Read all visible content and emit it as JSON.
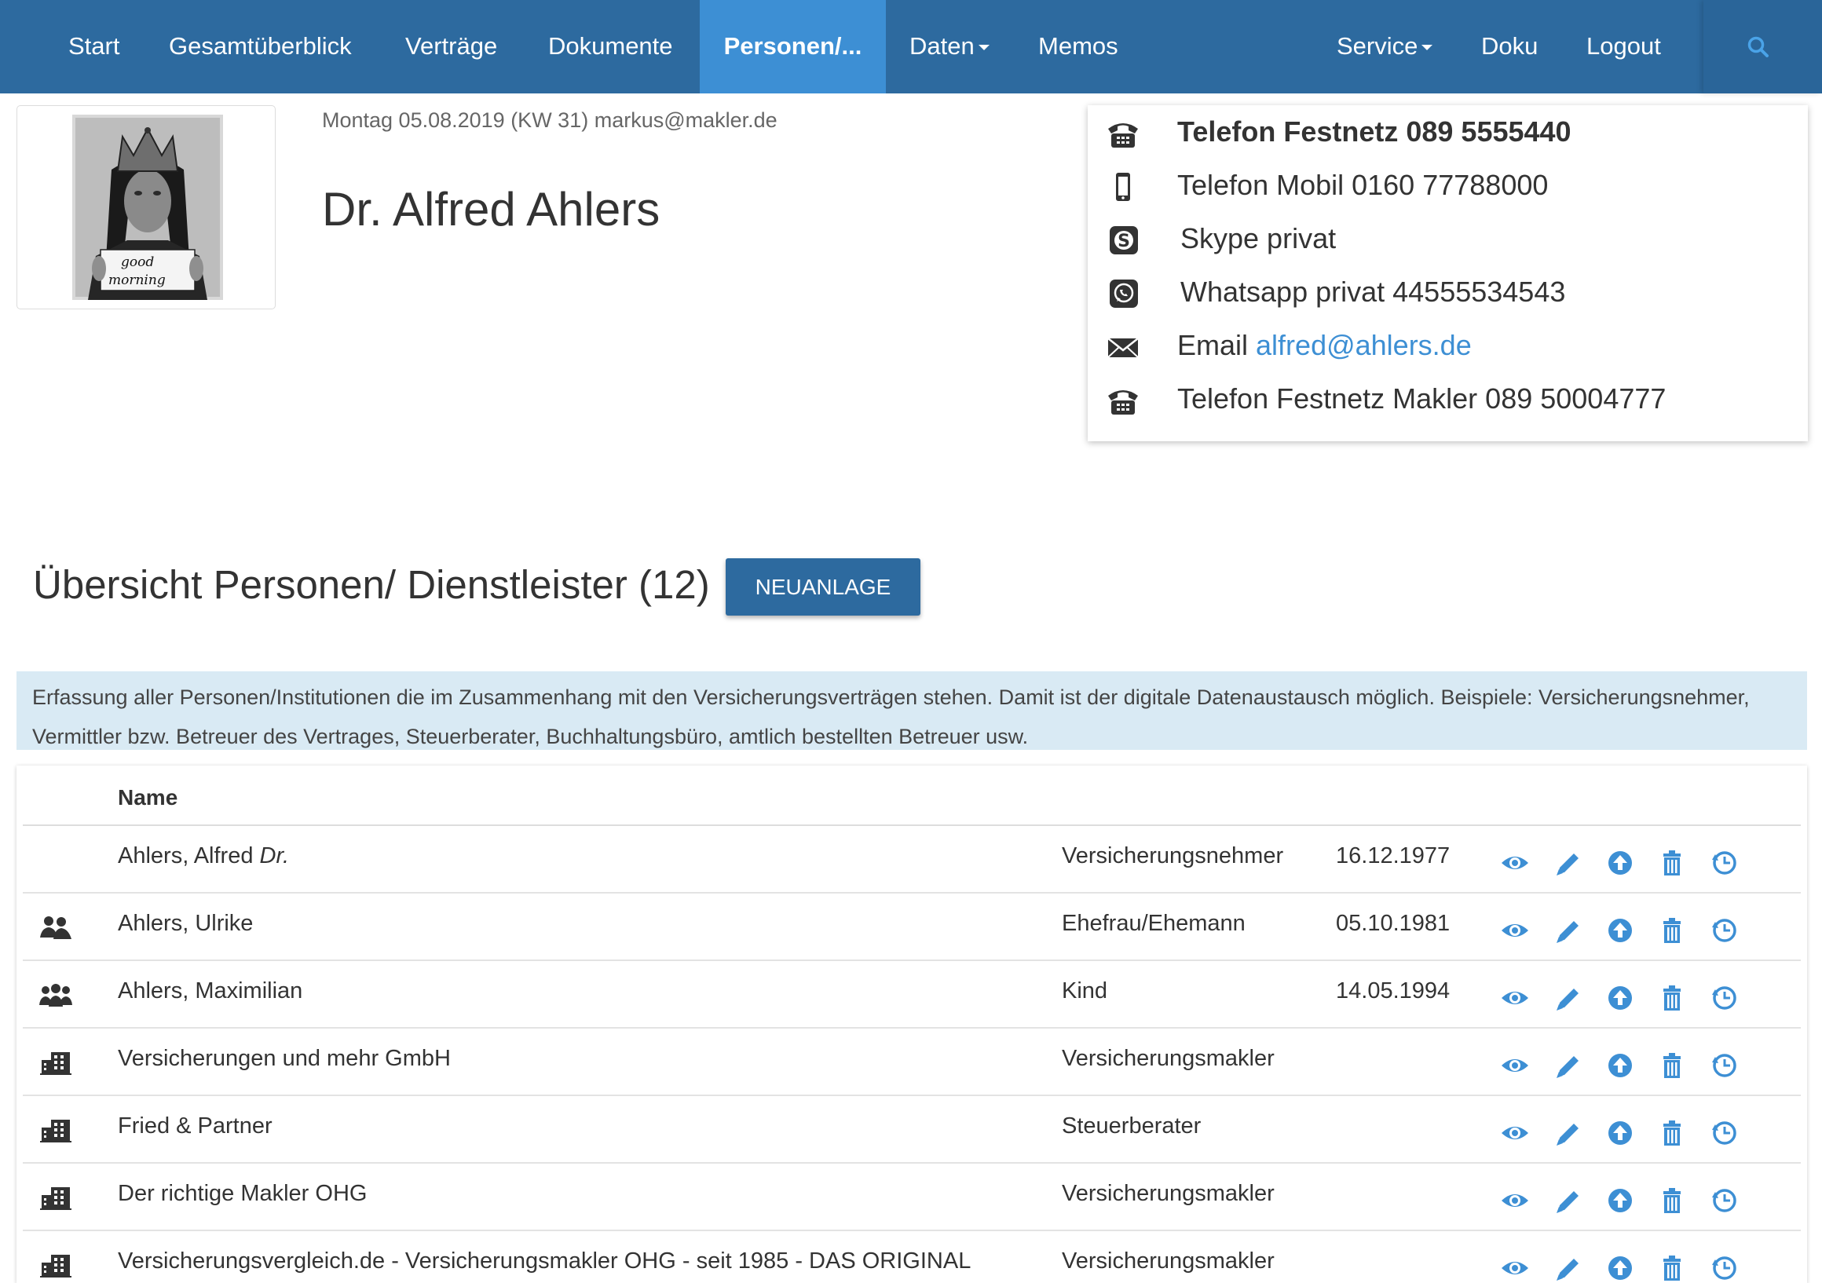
{
  "nav": {
    "items": [
      {
        "label": "Start"
      },
      {
        "label": "Gesamtüberblick"
      },
      {
        "label": "Verträge"
      },
      {
        "label": "Dokumente"
      },
      {
        "label": "Personen/..."
      },
      {
        "label": "Daten"
      },
      {
        "label": "Memos"
      },
      {
        "label": "Service"
      },
      {
        "label": "Doku"
      },
      {
        "label": "Logout"
      }
    ],
    "active": "Personen/...",
    "search_icon": "search-icon"
  },
  "profile": {
    "photo_icon": "profile-photo",
    "date_line": "Montag 05.08.2019 (KW 31) markus@makler.de",
    "name": "Dr. Alfred Ahlers"
  },
  "contacts": [
    {
      "icon": "phone-icon",
      "text": "Telefon Festnetz 089 5555440",
      "bold": true
    },
    {
      "icon": "mobile-icon",
      "text": "Telefon Mobil 0160 77788000"
    },
    {
      "icon": "skype-icon",
      "text": "Skype privat"
    },
    {
      "icon": "whatsapp-icon",
      "text": "Whatsapp privat 44555534543"
    },
    {
      "icon": "mail-icon",
      "label": "Email ",
      "link": "alfred@ahlers.de"
    },
    {
      "icon": "phone-icon",
      "text": "Telefon Festnetz Makler 089 50004777"
    }
  ],
  "section": {
    "title": "Übersicht Personen/ Dienstleister (12)",
    "new_button": "NEUANLAGE"
  },
  "info_text": "Erfassung aller Personen/Institutionen die im Zusammenhang mit den Versicherungsverträgen stehen. Damit ist der digitale Datenaustausch möglich. Beispiele: Versicherungsnehmer, Vermittler bzw. Betreuer des Vertrages, Steuerberater, Buchhaltungsbüro, amtlich bestellten Betreuer usw.",
  "table": {
    "header_name": "Name",
    "rows": [
      {
        "icon": "",
        "name": "Ahlers, Alfred ",
        "name_suffix": "Dr.",
        "role": "Versicherungsnehmer",
        "date": "16.12.1977"
      },
      {
        "icon": "couple-icon",
        "name": "Ahlers, Ulrike",
        "role": "Ehefrau/Ehemann",
        "date": "05.10.1981"
      },
      {
        "icon": "family-icon",
        "name": "Ahlers, Maximilian",
        "role": "Kind",
        "date": "14.05.1994"
      },
      {
        "icon": "building-icon",
        "name": "Versicherungen und mehr GmbH",
        "role": "Versicherungsmakler",
        "date": ""
      },
      {
        "icon": "building-icon",
        "name": "Fried & Partner",
        "role": "Steuerberater",
        "date": ""
      },
      {
        "icon": "building-icon",
        "name": "Der richtige Makler OHG",
        "role": "Versicherungsmakler",
        "date": ""
      },
      {
        "icon": "building-icon",
        "name": "Versicherungsvergleich.de - Versicherungsmakler OHG - seit 1985 - DAS ORIGINAL",
        "role": "Versicherungsmakler",
        "date": ""
      }
    ],
    "action_icons": [
      "eye-icon",
      "edit-icon",
      "upload-icon",
      "trash-icon",
      "history-icon"
    ]
  },
  "colors": {
    "navbar": "#2d6a9f",
    "nav_active": "#3d8fd4",
    "link": "#3d8fd4",
    "info_bg": "#d9eaf4",
    "action_icon": "#3d8fd4"
  }
}
